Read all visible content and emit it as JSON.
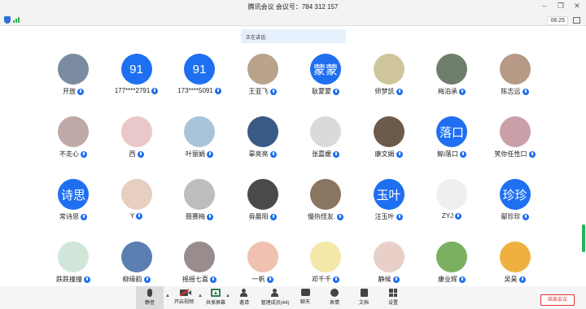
{
  "window": {
    "title": "腾讯会议  会议号：784 312 157",
    "minimize_icon": "minimize-icon",
    "maximize_icon": "restore-icon",
    "close_icon": "close-icon"
  },
  "status": {
    "security_icon": "shield-icon",
    "signal_icon": "signal-icon",
    "timer": "06:25",
    "layout_icon": "grid-view-icon"
  },
  "speaking": {
    "label": "正在讲话:"
  },
  "participants": [
    {
      "name": "开放",
      "avatar_text": "",
      "avatar_color": "#7a8aa0"
    },
    {
      "name": "177****2791",
      "avatar_text": "91",
      "avatar_color": "#1f6ff1"
    },
    {
      "name": "173****5091",
      "avatar_text": "91",
      "avatar_color": "#1f6ff1"
    },
    {
      "name": "王亚飞",
      "avatar_text": "",
      "avatar_color": "#b9a38c"
    },
    {
      "name": "耿蒙蒙",
      "avatar_text": "蒙蒙",
      "avatar_color": "#1f6ff1"
    },
    {
      "name": "师梦凯",
      "avatar_text": "",
      "avatar_color": "#cfc59b"
    },
    {
      "name": "梅泊承",
      "avatar_text": "",
      "avatar_color": "#6e7e6a"
    },
    {
      "name": "陈志远",
      "avatar_text": "",
      "avatar_color": "#b69a86"
    },
    {
      "name": "不走心",
      "avatar_text": "",
      "avatar_color": "#c1a8a8"
    },
    {
      "name": "西",
      "avatar_text": "",
      "avatar_color": "#e8c8c8"
    },
    {
      "name": "叶丽娟",
      "avatar_text": "",
      "avatar_color": "#a8c4da"
    },
    {
      "name": "辜亮亮",
      "avatar_text": "",
      "avatar_color": "#3a5a86"
    },
    {
      "name": "张嘉媛",
      "avatar_text": "",
      "avatar_color": "#dadada"
    },
    {
      "name": "康文娟",
      "avatar_text": "",
      "avatar_color": "#6c5a4a"
    },
    {
      "name": "鲸i落口",
      "avatar_text": "落口",
      "avatar_color": "#1f6ff1"
    },
    {
      "name": "笑你任性口",
      "avatar_text": "",
      "avatar_color": "#c9a0a8"
    },
    {
      "name": "常诗思",
      "avatar_text": "诗思",
      "avatar_color": "#1f6ff1"
    },
    {
      "name": "Y",
      "avatar_text": "",
      "avatar_color": "#e6cfc0"
    },
    {
      "name": "聂赛梅",
      "avatar_text": "",
      "avatar_color": "#bdbdbd"
    },
    {
      "name": "毋晨阳",
      "avatar_text": "",
      "avatar_color": "#4a4a4a"
    },
    {
      "name": "慢热怪友.",
      "avatar_text": "",
      "avatar_color": "#8a7560"
    },
    {
      "name": "汪玉叶",
      "avatar_text": "玉叶",
      "avatar_color": "#1f6ff1"
    },
    {
      "name": "ZYJ",
      "avatar_text": "",
      "avatar_color": "#efefef"
    },
    {
      "name": "鄢珍珍",
      "avatar_text": "珍珍",
      "avatar_color": "#1f6ff1"
    },
    {
      "name": "跌跌撞撞",
      "avatar_text": "",
      "avatar_color": "#cfe6d8"
    },
    {
      "name": "柳缘韵",
      "avatar_text": "",
      "avatar_color": "#5a7fb0"
    },
    {
      "name": "摇摇七喜",
      "avatar_text": "",
      "avatar_color": "#9a8c8c"
    },
    {
      "name": "一帆",
      "avatar_text": "",
      "avatar_color": "#f0c0b0"
    },
    {
      "name": "邓千千",
      "avatar_text": "",
      "avatar_color": "#f4e8a8"
    },
    {
      "name": "静候",
      "avatar_text": "",
      "avatar_color": "#e8d0c8"
    },
    {
      "name": "康业辉",
      "avatar_text": "",
      "avatar_color": "#7ab060"
    },
    {
      "name": "吴昊",
      "avatar_text": "",
      "avatar_color": "#f0b040"
    }
  ],
  "toolbar": {
    "mute": "静音",
    "video": "开启视频",
    "share": "共享屏幕",
    "invite": "邀请",
    "members": "管理成员(44)",
    "chat": "聊天",
    "emoji": "表情",
    "docs": "文档",
    "settings": "设置",
    "end": "结束会议"
  },
  "colors": {
    "accent": "#1f6ff1",
    "end_red": "#e03131",
    "signal_green": "#2bb24c"
  }
}
